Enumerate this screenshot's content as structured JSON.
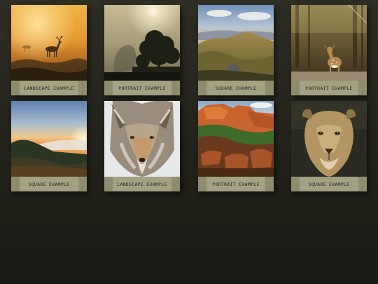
{
  "gallery": {
    "items": [
      {
        "caption": "LANDSCAPE EXAMPLE",
        "subject": "deer-in-mist-photo"
      },
      {
        "caption": "PORTRAIT EXAMPLE",
        "subject": "misty-tree-photo"
      },
      {
        "caption": "SQUARE EXAMPLE",
        "subject": "mountain-ridge-photo"
      },
      {
        "caption": "PORTRAIT EXAMPLE",
        "subject": "fawn-in-forest-photo"
      },
      {
        "caption": "SQUARE EXAMPLE",
        "subject": "sunset-hills-photo"
      },
      {
        "caption": "LANDSCAPE EXAMPLE",
        "subject": "coyote-in-snow-photo"
      },
      {
        "caption": "PORTRAIT EXAMPLE",
        "subject": "red-rock-canyon-photo"
      },
      {
        "caption": "SQUARE EXAMPLE",
        "subject": "lioness-photo"
      }
    ]
  },
  "colors": {
    "background": "#25251d",
    "caption_outer": "#8f8c6e",
    "caption_inner": "#a3a181",
    "caption_text": "#2b2a20"
  }
}
